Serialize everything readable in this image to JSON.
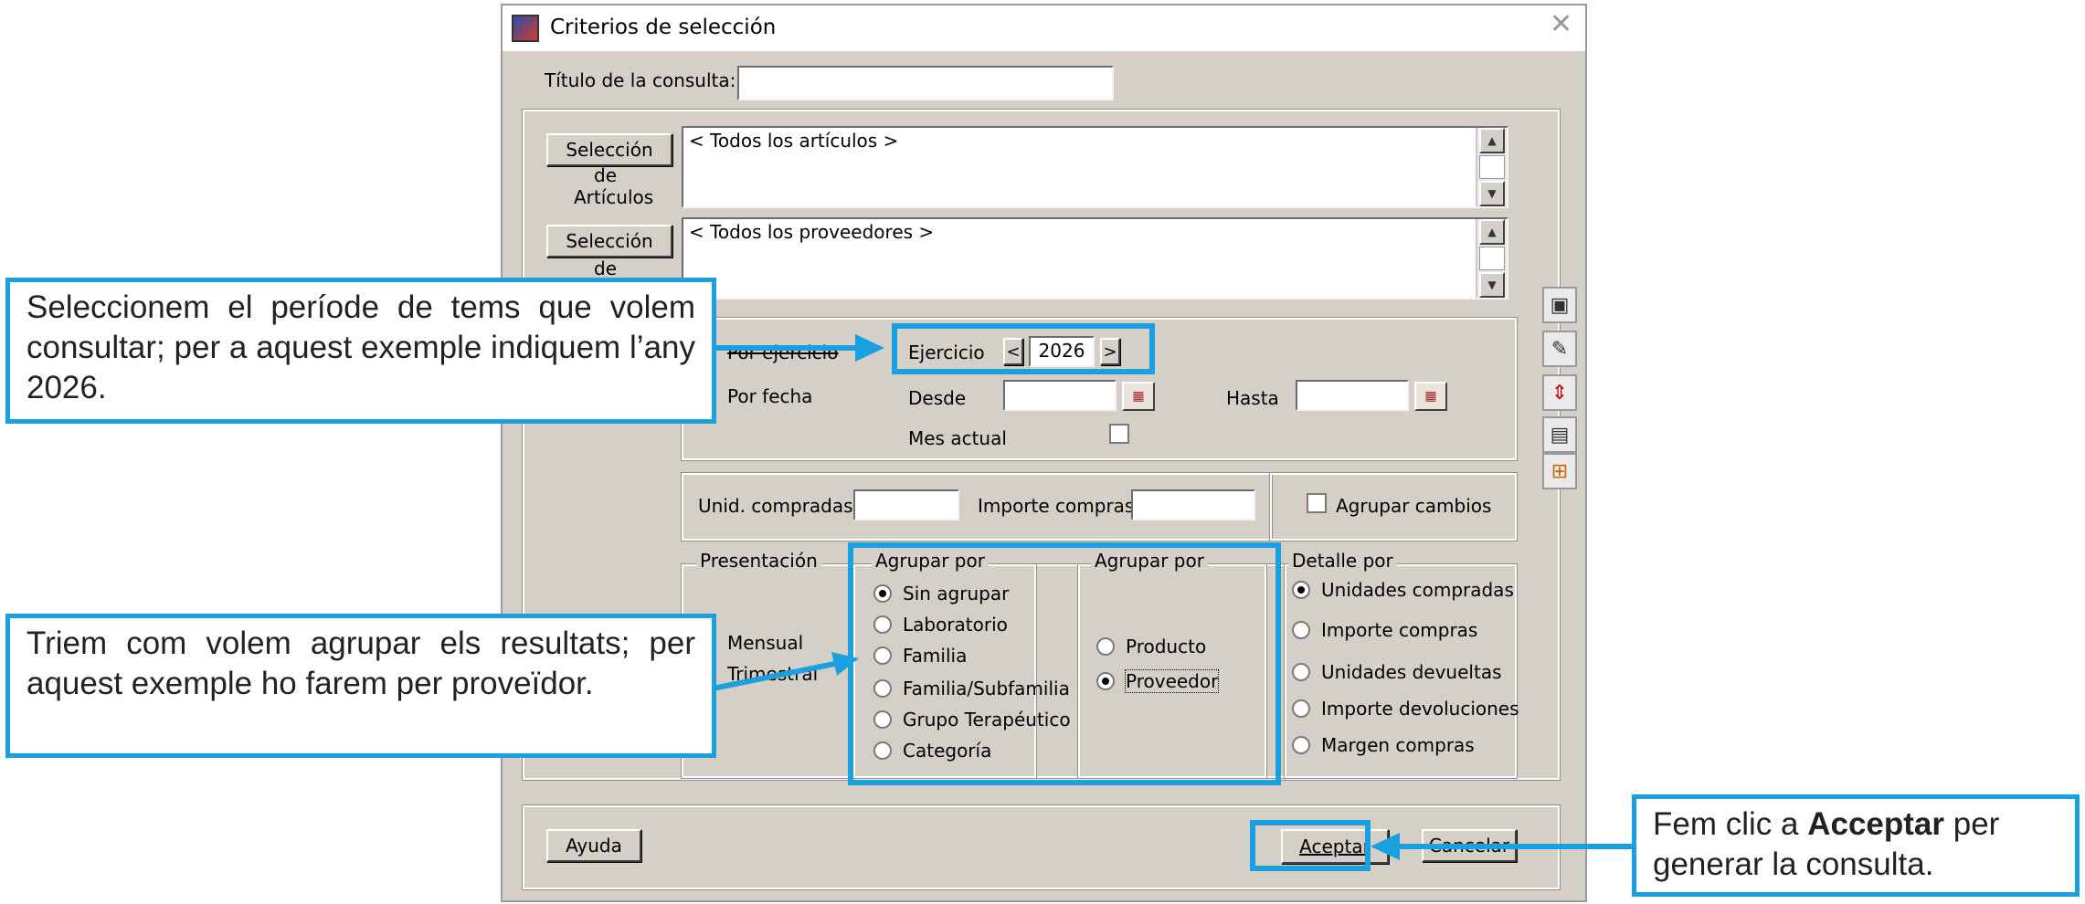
{
  "window": {
    "title": "Criterios de selección"
  },
  "query": {
    "title_label": "Título de la consulta:",
    "title_value": ""
  },
  "articles": {
    "button": [
      "Selección",
      "de",
      "Artículos"
    ],
    "list_text": "< Todos los artículos >"
  },
  "providers": {
    "button": [
      "Selección",
      "de"
    ],
    "list_text": "< Todos los proveedores >"
  },
  "period": {
    "by_exercise_label": "Por ejercicio",
    "by_date_label": "Por fecha",
    "exercise_label": "Ejercicio",
    "prev_label": "<",
    "next_label": ">",
    "year": "2026",
    "from_label": "Desde",
    "to_label": "Hasta",
    "current_month_label": "Mes actual"
  },
  "filters": {
    "units_label": "Unid. compradas",
    "amount_label": "Importe compras",
    "group_changes_label": "Agrupar cambios"
  },
  "presentation": {
    "legend": "Presentación",
    "options": [
      "Mensual",
      "Trimestral"
    ]
  },
  "group_by_1": {
    "legend": "Agrupar por",
    "options": [
      "Sin agrupar",
      "Laboratorio",
      "Familia",
      "Familia/Subfamilia",
      "Grupo Terapéutico",
      "Categoría"
    ],
    "selected": "Sin agrupar"
  },
  "group_by_2": {
    "legend": "Agrupar por",
    "options": [
      "Producto",
      "Proveedor"
    ],
    "selected": "Proveedor"
  },
  "detail_by": {
    "legend": "Detalle por",
    "options": [
      "Unidades compradas",
      "Importe compras",
      "Unidades devueltas",
      "Importe devoluciones",
      "Margen compras"
    ],
    "selected": "Unidades compradas"
  },
  "footer": {
    "help": "Ayuda",
    "accept": "Aceptar",
    "cancel": "Cancelar"
  },
  "callouts": {
    "period": "Seleccionem el període de tems que volem consultar; per a aquest exemple indiquem l’any 2026.",
    "grouping": "Triem com volem agrupar els resultats; per aquest exemple ho farem per proveïdor.",
    "accept_pre": "Fem clic a ",
    "accept_bold": "Acceptar",
    "accept_post": " per generar la consulta."
  },
  "colors": {
    "annotation": "#1aa0df",
    "dialog_bg": "#d4d0c8"
  }
}
